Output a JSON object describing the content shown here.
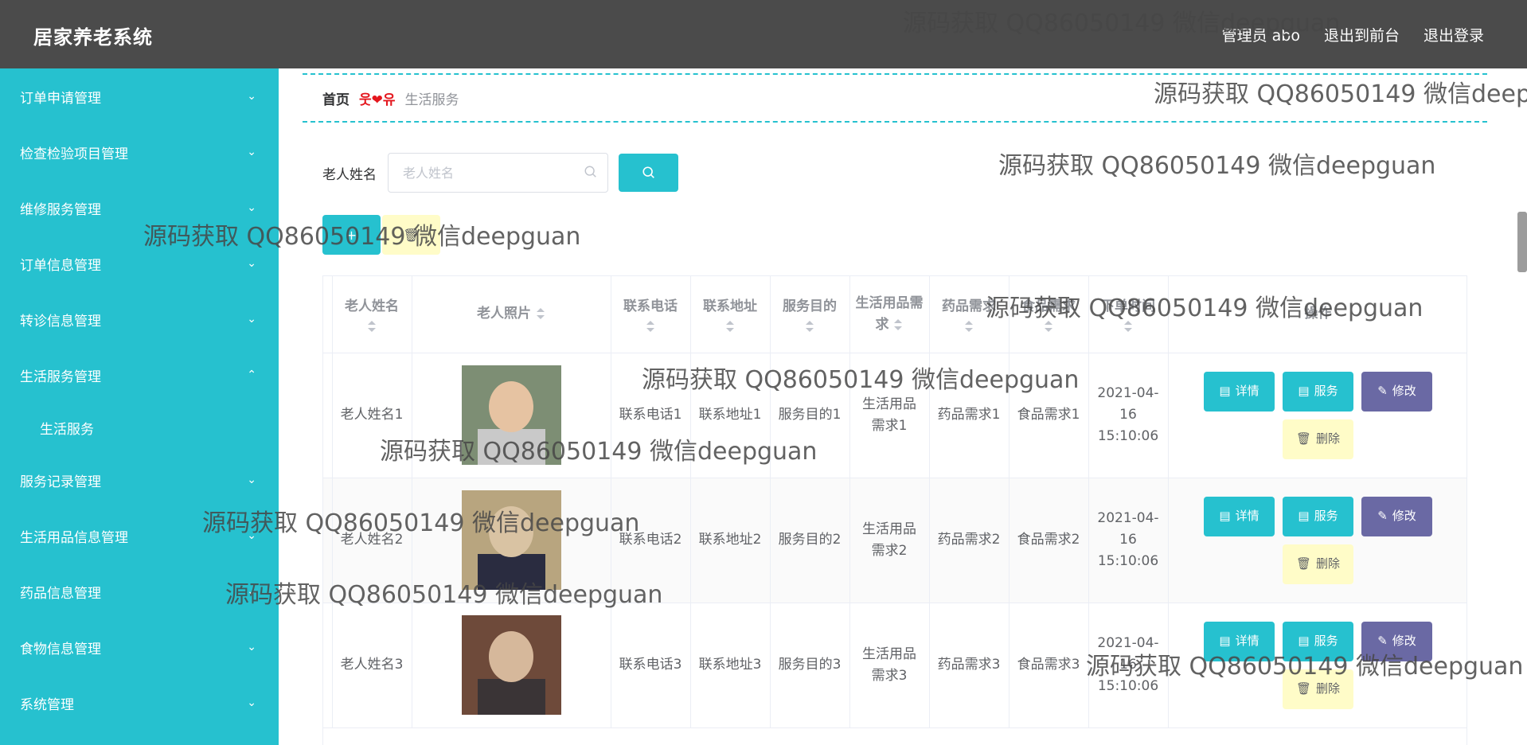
{
  "app": {
    "title": "居家养老系统"
  },
  "header": {
    "user_label": "管理员 abo",
    "frontend_link": "退出到前台",
    "logout_link": "退出登录"
  },
  "sidebar": {
    "items": [
      {
        "label": "订单申请管理",
        "expanded": false
      },
      {
        "label": "检查检验项目管理",
        "expanded": false
      },
      {
        "label": "维修服务管理",
        "expanded": false
      },
      {
        "label": "订单信息管理",
        "expanded": false
      },
      {
        "label": "转诊信息管理",
        "expanded": false
      },
      {
        "label": "生活服务管理",
        "expanded": true,
        "children": [
          {
            "label": "生活服务"
          }
        ]
      },
      {
        "label": "服务记录管理",
        "expanded": false
      },
      {
        "label": "生活用品信息管理",
        "expanded": false
      },
      {
        "label": "药品信息管理",
        "expanded": false
      },
      {
        "label": "食物信息管理",
        "expanded": false
      },
      {
        "label": "系统管理",
        "expanded": false
      }
    ]
  },
  "breadcrumb": {
    "home": "首页",
    "separator": "웃❤유",
    "current": "生活服务"
  },
  "search": {
    "label": "老人姓名",
    "placeholder": "老人姓名",
    "value": ""
  },
  "table": {
    "headers": [
      "老人姓名",
      "老人照片",
      "联系电话",
      "联系地址",
      "服务目的",
      "生活用品需求",
      "药品需求",
      "食品需求",
      "下单时间",
      "操作"
    ],
    "rows": [
      {
        "name": "老人姓名1",
        "phone": "联系电话1",
        "address": "联系地址1",
        "purpose": "服务目的1",
        "goods": "生活用品需求1",
        "medicine": "药品需求1",
        "food": "食品需求1",
        "time": "2021-04-16 15:10:06"
      },
      {
        "name": "老人姓名2",
        "phone": "联系电话2",
        "address": "联系地址2",
        "purpose": "服务目的2",
        "goods": "生活用品需求2",
        "medicine": "药品需求2",
        "food": "食品需求2",
        "time": "2021-04-16 15:10:06"
      },
      {
        "name": "老人姓名3",
        "phone": "联系电话3",
        "address": "联系地址3",
        "purpose": "服务目的3",
        "goods": "生活用品需求3",
        "medicine": "药品需求3",
        "food": "食品需求3",
        "time": "2021-04-16 15:10:06"
      }
    ],
    "actions": {
      "detail": "详情",
      "service": "服务",
      "edit": "修改",
      "delete": "删除"
    }
  },
  "watermark": "源码获取 QQ86050149 微信deepguan",
  "colors": {
    "header_bg": "#4b4b4b",
    "sidebar_bg": "#26c1cf",
    "primary": "#26c1cf",
    "edit_button": "#6a69a4",
    "delete_button": "#fffcc8"
  }
}
